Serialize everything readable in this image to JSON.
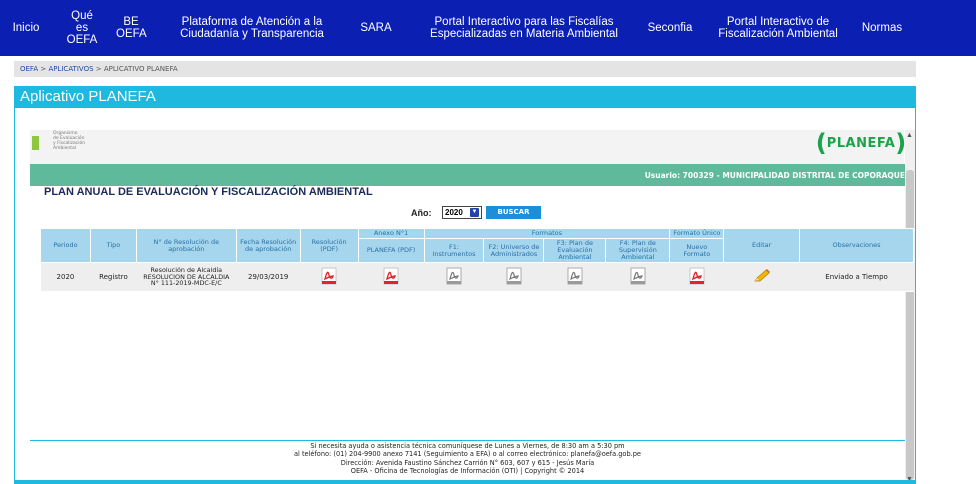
{
  "topnav": {
    "items": [
      {
        "label": "Inicio"
      },
      {
        "label": "Qué\nes\nOEFA"
      },
      {
        "label": "BE\nOEFA"
      },
      {
        "label": "Plataforma de Atención a la\nCiudadanía y Transparencia"
      },
      {
        "label": "SARA"
      },
      {
        "label": "Portal Interactivo para las Fiscalías\nEspecializadas en Materia Ambiental"
      },
      {
        "label": "Seconfia"
      },
      {
        "label": "Portal Interactivo de\nFiscalización Ambiental"
      },
      {
        "label": "Normas"
      }
    ]
  },
  "breadcrumb": {
    "item1": "OEFA",
    "sep1": ">",
    "item2": "APLICATIVOS",
    "sep2": ">",
    "item3": "APLICATIVO PLANEFA"
  },
  "app": {
    "title": "Aplicativo PLANEFA",
    "org_name": "Organismo\nde Evaluación\ny Fiscalización\nAmbiental",
    "logo_text": "PLANEFA",
    "user_text": "Usuario: 700329 - MUNICIPALIDAD DISTRITAL DE COPORAQUE",
    "plan_title": "PLAN ANUAL DE EVALUACIÓN Y FISCALIZACIÓN AMBIENTAL"
  },
  "filter": {
    "year_label": "Año:",
    "year_value": "2020",
    "search_button": "BUSCAR"
  },
  "table": {
    "headers": {
      "periodo": "Periodo",
      "tipo": "Tipo",
      "resolucion_num": "N° de Resolución de aprobación",
      "fecha": "Fecha Resolución de aprobación",
      "resolucion_pdf": "Resolución (PDF)",
      "anexo1": "Anexo N°1",
      "formatos": "Formatos",
      "formato_unico": "Formato Único",
      "editar": "Editar",
      "observaciones": "Observaciones",
      "planefa_pdf": "PLANEFA (PDF)",
      "f1": "F1: Instrumentos",
      "f2": "F2: Universo de Administrados",
      "f3": "F3: Plan de Evaluación Ambiental",
      "f4": "F4: Plan de Supervisión Ambiental",
      "nuevo_formato": "Nuevo Formato"
    },
    "rows": [
      {
        "periodo": "2020",
        "tipo": "Registro",
        "resolucion": "Resolución de Alcaldía RESOLUCION DE ALCALDIA N° 111-2019-MDC-E/C",
        "fecha": "29/03/2019",
        "observaciones": "Enviado a Tiempo"
      }
    ]
  },
  "footer": {
    "line1": "Si necesita ayuda o asistencia técnica comuníquese de Lunes a Viernes, de 8:30 am a 5:30 pm",
    "line2": "al teléfono: (01) 204-9900 anexo 7141 (Seguimiento a EFA) o al correo electrónico: planefa@oefa.gob.pe",
    "line3": "Dirección: Avenida Faustino Sánchez Carrión N° 603, 607 y 615 - Jesús María",
    "line4": "OEFA - Oficina de Tecnologías de Información (OTI) | Copyright © 2014"
  },
  "colors": {
    "nav_bg": "#0b1fb2",
    "accent": "#1fb8df",
    "user_bar": "#5fb99b",
    "table_header": "#a5d6ee",
    "pdf_red": "#e0242a",
    "logo_green": "#1aa34a"
  },
  "icons": {
    "pdf": "pdf-file-icon",
    "document": "document-icon",
    "edit": "pencil-icon"
  }
}
